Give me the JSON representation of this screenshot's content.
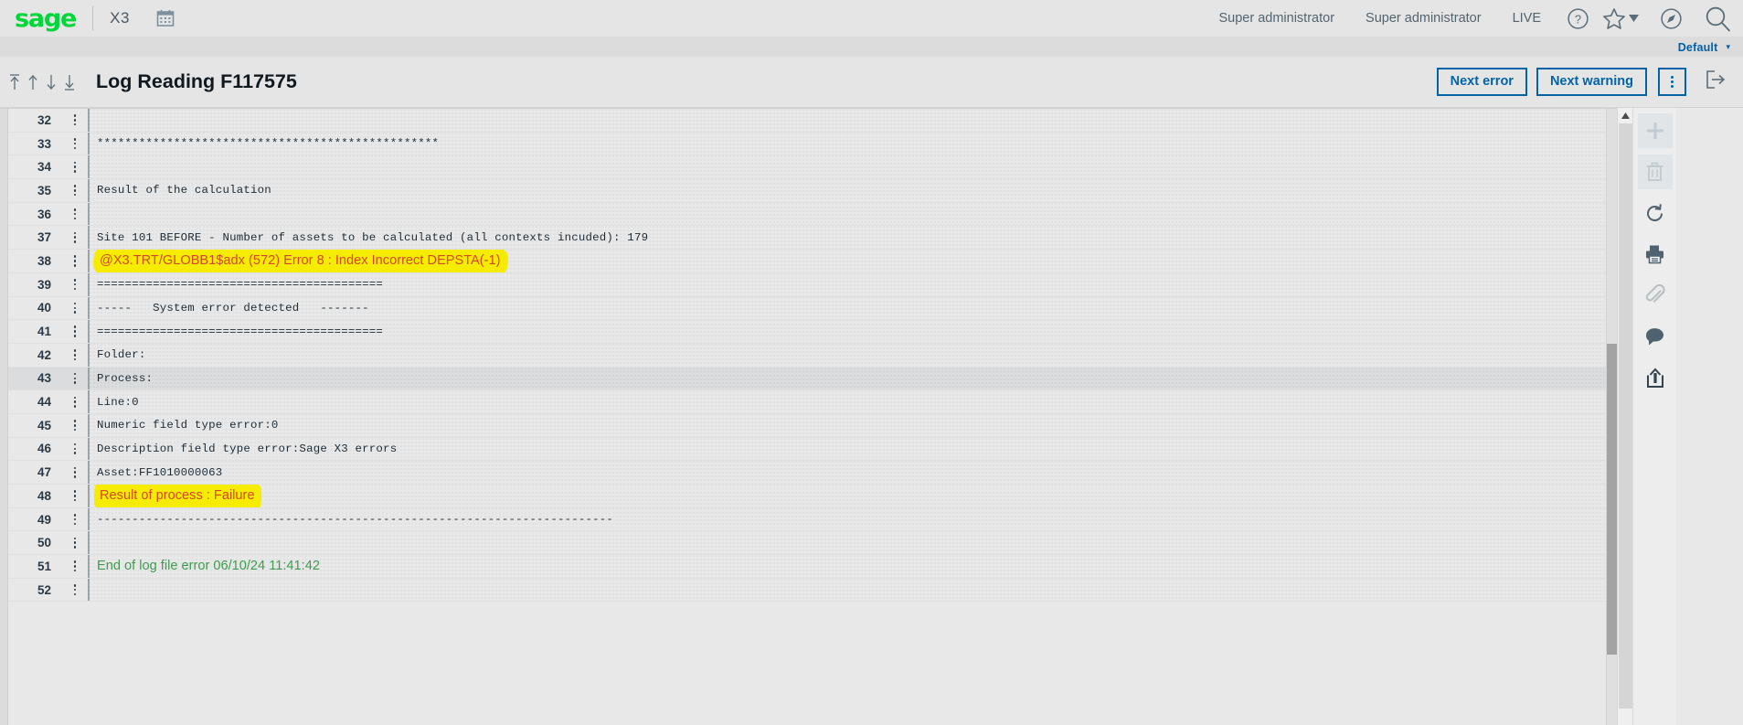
{
  "header": {
    "brand": "sage",
    "product": "X3",
    "calendar_icon": "calendar-icon",
    "user_primary": "Super administrator",
    "user_secondary": "Super administrator",
    "environment": "LIVE",
    "help_icon": "help-icon",
    "favorites_icon": "star-icon",
    "navigator_icon": "compass-icon",
    "search_icon": "search-icon",
    "brand_color": "#00d639",
    "accent_color": "#0064a6"
  },
  "subheader": {
    "view_label": "Default",
    "caret": "▾"
  },
  "titlebar": {
    "nav_first": "first-record-icon",
    "nav_prev": "previous-record-icon",
    "nav_next": "next-record-icon",
    "nav_last": "last-record-icon",
    "title": "Log Reading F117575",
    "next_error_label": "Next error",
    "next_warning_label": "Next warning",
    "more_label": "more-actions",
    "exit_label": "exit-icon"
  },
  "rail": {
    "items": [
      {
        "name": "add-icon",
        "glyph": "+",
        "disabled": true
      },
      {
        "name": "delete-icon",
        "glyph": "trash",
        "disabled": true
      },
      {
        "name": "refresh-icon",
        "glyph": "refresh",
        "disabled": false
      },
      {
        "name": "print-icon",
        "glyph": "printer",
        "disabled": false
      },
      {
        "name": "attachment-icon",
        "glyph": "paperclip",
        "disabled": false
      },
      {
        "name": "comment-icon",
        "glyph": "bubble",
        "disabled": false
      },
      {
        "name": "export-icon",
        "glyph": "upload",
        "disabled": false
      }
    ]
  },
  "log": {
    "rows": [
      {
        "n": "32",
        "text": "",
        "style": "mono",
        "highlight": "none",
        "row_selected": false
      },
      {
        "n": "33",
        "text": "*************************************************",
        "style": "mono",
        "highlight": "none",
        "row_selected": false
      },
      {
        "n": "34",
        "text": "",
        "style": "mono",
        "highlight": "none",
        "row_selected": false
      },
      {
        "n": "35",
        "text": "Result of the calculation",
        "style": "mono",
        "highlight": "none",
        "row_selected": false
      },
      {
        "n": "36",
        "text": "",
        "style": "mono",
        "highlight": "none",
        "row_selected": false
      },
      {
        "n": "37",
        "text": "Site 101 BEFORE - Number of assets to be calculated (all contexts incuded): 179",
        "style": "mono",
        "highlight": "none",
        "row_selected": false
      },
      {
        "n": "38",
        "text": "@X3.TRT/GLOBB1$adx (572) Error 8 : Index Incorrect DEPSTA(-1)",
        "style": "error",
        "highlight": "marker-wide",
        "row_selected": false
      },
      {
        "n": "39",
        "text": "=========================================",
        "style": "mono",
        "highlight": "none",
        "row_selected": false
      },
      {
        "n": "40",
        "text": "-----   System error detected   -------",
        "style": "mono",
        "highlight": "none",
        "row_selected": false
      },
      {
        "n": "41",
        "text": "=========================================",
        "style": "mono",
        "highlight": "none",
        "row_selected": false
      },
      {
        "n": "42",
        "text": "Folder:",
        "style": "mono",
        "highlight": "none",
        "row_selected": false
      },
      {
        "n": "43",
        "text": "Process:",
        "style": "mono",
        "highlight": "none",
        "row_selected": true
      },
      {
        "n": "44",
        "text": "Line:0",
        "style": "mono",
        "highlight": "none",
        "row_selected": false
      },
      {
        "n": "45",
        "text": "Numeric field type error:0",
        "style": "mono",
        "highlight": "none",
        "row_selected": false
      },
      {
        "n": "46",
        "text": "Description field type error:Sage X3 errors",
        "style": "mono",
        "highlight": "none",
        "row_selected": false
      },
      {
        "n": "47",
        "text": "Asset:FF1010000063",
        "style": "mono",
        "highlight": "none",
        "row_selected": false
      },
      {
        "n": "48",
        "text": "Result of process : Failure",
        "style": "error",
        "highlight": "marker",
        "row_selected": false
      },
      {
        "n": "49",
        "text": "--------------------------------------------------------------------------",
        "style": "mono",
        "highlight": "none",
        "row_selected": false
      },
      {
        "n": "50",
        "text": "",
        "style": "mono",
        "highlight": "none",
        "row_selected": false
      },
      {
        "n": "51",
        "text": "End of log file error 06/10/24 11:41:42",
        "style": "ok",
        "highlight": "none",
        "row_selected": false
      },
      {
        "n": "52",
        "text": "",
        "style": "mono",
        "highlight": "none",
        "row_selected": false
      }
    ],
    "kebab_label": "row-actions"
  },
  "scrollbars": {
    "inner_thumb_top_pct": 38,
    "inner_thumb_height_pct": 50,
    "page_scroll_up": "scroll-up-arrow"
  }
}
